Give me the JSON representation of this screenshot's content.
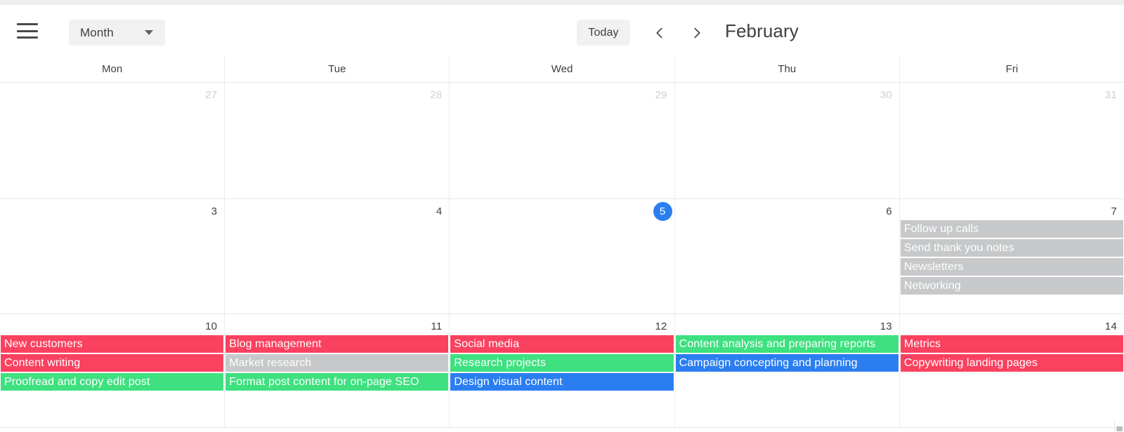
{
  "toolbar": {
    "menu_icon": "hamburger-menu-icon",
    "view_selector": {
      "value": "Month",
      "caret_icon": "chevron-down-icon",
      "options": [
        "Month"
      ]
    },
    "today_label": "Today",
    "prev_icon": "chevron-left-icon",
    "next_icon": "chevron-right-icon",
    "month_title": "February"
  },
  "calendar": {
    "weekdays": [
      "Mon",
      "Tue",
      "Wed",
      "Thu",
      "Fri"
    ],
    "today_date": "5",
    "colors": {
      "red": "#fa415f",
      "green": "#3ee07f",
      "blue": "#2b7ef0",
      "gray": "#c6c8ca",
      "today_badge": "#2b7ef0"
    },
    "weeks": [
      {
        "days": [
          {
            "number": "27",
            "other_month": true,
            "is_today": false,
            "events": []
          },
          {
            "number": "28",
            "other_month": true,
            "is_today": false,
            "events": []
          },
          {
            "number": "29",
            "other_month": true,
            "is_today": false,
            "events": []
          },
          {
            "number": "30",
            "other_month": true,
            "is_today": false,
            "events": []
          },
          {
            "number": "31",
            "other_month": true,
            "is_today": false,
            "events": []
          }
        ]
      },
      {
        "days": [
          {
            "number": "3",
            "other_month": false,
            "is_today": false,
            "events": []
          },
          {
            "number": "4",
            "other_month": false,
            "is_today": false,
            "events": []
          },
          {
            "number": "5",
            "other_month": false,
            "is_today": true,
            "events": []
          },
          {
            "number": "6",
            "other_month": false,
            "is_today": false,
            "events": []
          },
          {
            "number": "7",
            "other_month": false,
            "is_today": false,
            "events": [
              {
                "title": "Follow up calls",
                "color": "gray"
              },
              {
                "title": "Send thank you notes",
                "color": "gray"
              },
              {
                "title": "Newsletters",
                "color": "gray"
              },
              {
                "title": "Networking",
                "color": "gray"
              }
            ]
          }
        ]
      },
      {
        "days": [
          {
            "number": "10",
            "other_month": false,
            "is_today": false,
            "events": [
              {
                "title": "New customers",
                "color": "red"
              },
              {
                "title": "Content writing",
                "color": "red"
              },
              {
                "title": "Proofread and copy edit post",
                "color": "green"
              }
            ]
          },
          {
            "number": "11",
            "other_month": false,
            "is_today": false,
            "events": [
              {
                "title": "Blog management",
                "color": "red"
              },
              {
                "title": "Market research",
                "color": "gray"
              },
              {
                "title": "Format post content for on-page SEO",
                "color": "green"
              }
            ]
          },
          {
            "number": "12",
            "other_month": false,
            "is_today": false,
            "events": [
              {
                "title": "Social media",
                "color": "red"
              },
              {
                "title": "Research projects",
                "color": "green"
              },
              {
                "title": "Design visual content",
                "color": "blue"
              }
            ]
          },
          {
            "number": "13",
            "other_month": false,
            "is_today": false,
            "events": [
              {
                "title": "Content analysis and preparing reports",
                "color": "green"
              },
              {
                "title": "Campaign concepting and planning",
                "color": "blue"
              }
            ]
          },
          {
            "number": "14",
            "other_month": false,
            "is_today": false,
            "events": [
              {
                "title": "Metrics",
                "color": "red"
              },
              {
                "title": "Copywriting landing pages",
                "color": "red"
              }
            ]
          }
        ]
      }
    ]
  }
}
